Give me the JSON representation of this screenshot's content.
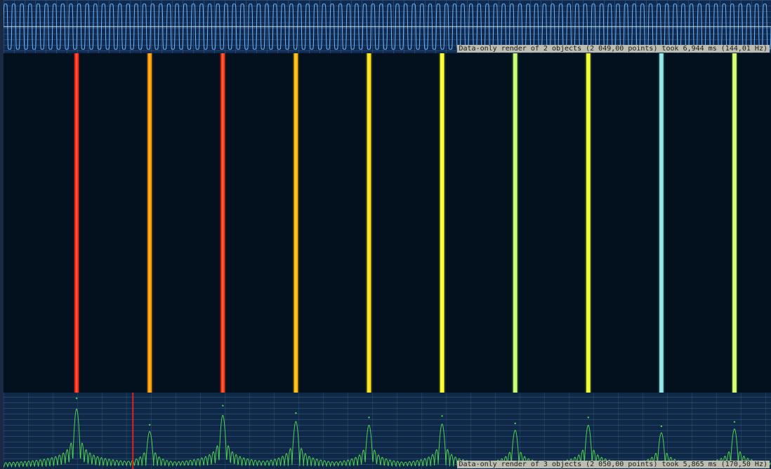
{
  "chart_data": [
    {
      "type": "line",
      "title": "",
      "xlabel": "",
      "ylabel": "",
      "grid": true,
      "cycles": 94,
      "amplitude": 0.85,
      "ylim": [
        -1,
        1
      ],
      "colors": {
        "background": "#0f2a4e",
        "grid": "#2a4d7a",
        "trace": "#6fb7ff",
        "baseline": "#d8e6f5"
      },
      "status_text": "Data-only render of 2 objects (2 049,00 points) took 6,944 ms (144,01 Hz)"
    },
    {
      "type": "heatmap",
      "title": "",
      "xlabel": "",
      "ylabel": "",
      "grid": false,
      "xlim": [
        0,
        1050
      ],
      "colors": {
        "background": "#03101e"
      },
      "peaks": [
        {
          "x": 100,
          "color": "#ff2a12"
        },
        {
          "x": 200,
          "color": "#ff9a00"
        },
        {
          "x": 300,
          "color": "#ff3814"
        },
        {
          "x": 400,
          "color": "#ffb800"
        },
        {
          "x": 500,
          "color": "#ffe10a"
        },
        {
          "x": 600,
          "color": "#ffff20"
        },
        {
          "x": 700,
          "color": "#c4ff66"
        },
        {
          "x": 800,
          "color": "#f0ff1e"
        },
        {
          "x": 900,
          "color": "#88e2e2"
        },
        {
          "x": 1000,
          "color": "#cfff60"
        }
      ]
    },
    {
      "type": "line",
      "title": "",
      "xlabel": "",
      "ylabel": "",
      "grid": true,
      "xlim": [
        0,
        1050
      ],
      "ylim": [
        0,
        1
      ],
      "cursor_x": 177,
      "colors": {
        "background": "#0e2846",
        "grid": "#2a4d7a",
        "trace": "#4fd04f",
        "cursor": "#e02020"
      },
      "peaks": [
        {
          "x": 100,
          "value": 0.96
        },
        {
          "x": 200,
          "value": 0.6
        },
        {
          "x": 300,
          "value": 0.86
        },
        {
          "x": 400,
          "value": 0.76
        },
        {
          "x": 500,
          "value": 0.7
        },
        {
          "x": 600,
          "value": 0.72
        },
        {
          "x": 700,
          "value": 0.62
        },
        {
          "x": 800,
          "value": 0.7
        },
        {
          "x": 900,
          "value": 0.58
        },
        {
          "x": 1000,
          "value": 0.64
        }
      ],
      "status_text": "Data-only render of 3 objects (2 050,00 points) took 5,865 ms (170,50 Hz)"
    }
  ]
}
